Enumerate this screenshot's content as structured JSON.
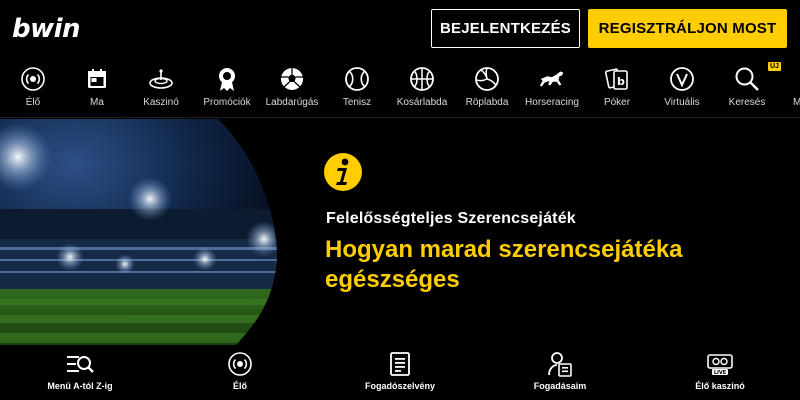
{
  "header": {
    "logo": "bwin",
    "login_label": "BEJELENTKEZÉS",
    "register_label": "REGISZTRÁLJON MOST"
  },
  "nav": {
    "items": [
      {
        "label": "Élő",
        "icon": "live-icon"
      },
      {
        "label": "Ma",
        "icon": "calendar-icon"
      },
      {
        "label": "Kaszinó",
        "icon": "roulette-icon"
      },
      {
        "label": "Promóciók",
        "icon": "medal-icon"
      },
      {
        "label": "Labdarúgás",
        "icon": "soccer-ball-icon"
      },
      {
        "label": "Tenisz",
        "icon": "tennis-ball-icon"
      },
      {
        "label": "Kosárlabda",
        "icon": "basketball-icon"
      },
      {
        "label": "Röplabda",
        "icon": "volleyball-icon"
      },
      {
        "label": "Horseracing",
        "icon": "horse-icon"
      },
      {
        "label": "Póker",
        "icon": "poker-cards-icon"
      },
      {
        "label": "Virtuális",
        "icon": "virtual-icon"
      },
      {
        "label": "Keresés",
        "icon": "search-icon"
      },
      {
        "label": "Mu",
        "icon": "more-icon"
      }
    ],
    "search_badge": "ÚJ"
  },
  "banner": {
    "subtitle": "Felelősségteljes Szerencsejáték",
    "title": "Hogyan marad szerencsejátéka egészséges"
  },
  "bottom_nav": {
    "items": [
      {
        "label": "Menü A-tól Z-ig",
        "icon": "menu-search-icon"
      },
      {
        "label": "Élő",
        "icon": "live-icon"
      },
      {
        "label": "Fogadószelvény",
        "icon": "betslip-icon"
      },
      {
        "label": "Fogadásaim",
        "icon": "my-bets-icon"
      },
      {
        "label": "Élő kaszinó",
        "icon": "live-casino-icon"
      }
    ],
    "live_casino_tag": "LIVE"
  },
  "colors": {
    "accent": "#ffcd00",
    "background": "#000000"
  }
}
